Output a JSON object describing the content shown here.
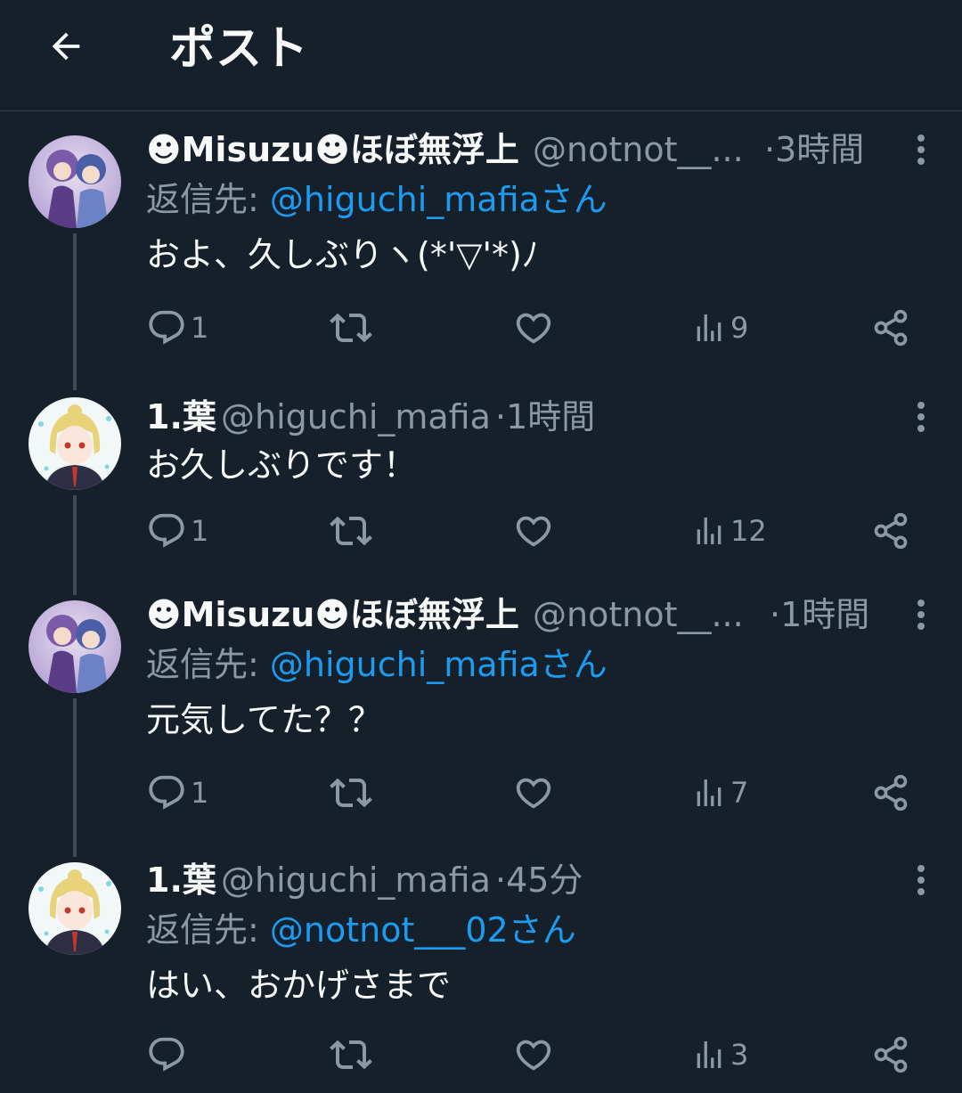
{
  "header": {
    "title": "ポスト"
  },
  "tweets": [
    {
      "display_name": "☻Misuzu☻ほぼ無浮上",
      "handle": "@notnot__...",
      "time": "·3時間",
      "reply_prefix": "返信先: ",
      "reply_to": "@higuchi_mafiaさん",
      "text": "およ、久しぶりヽ(*'▽'*)ﾉ",
      "replies": "1",
      "retweets": "",
      "likes": "",
      "views": "9"
    },
    {
      "display_name": "1.葉",
      "handle": "@higuchi_mafia",
      "time": "·1時間",
      "reply_prefix": "",
      "reply_to": "",
      "text": "お久しぶりです！",
      "replies": "1",
      "retweets": "",
      "likes": "",
      "views": "12"
    },
    {
      "display_name": "☻Misuzu☻ほぼ無浮上",
      "handle": "@notnot__...",
      "time": "·1時間",
      "reply_prefix": "返信先: ",
      "reply_to": "@higuchi_mafiaさん",
      "text": "元気してた？？",
      "replies": "1",
      "retweets": "",
      "likes": "",
      "views": "7"
    },
    {
      "display_name": "1.葉",
      "handle": "@higuchi_mafia",
      "time": "·45分",
      "reply_prefix": "返信先: ",
      "reply_to": "@notnot___02さん",
      "text": "はい、おかげさまで",
      "replies": "",
      "retweets": "",
      "likes": "",
      "views": "3"
    }
  ],
  "colors": {
    "background": "#15202b",
    "text": "#f7f9f9",
    "muted": "#8b98a5",
    "link": "#1d9bf0",
    "thread_line": "#3e4a55"
  },
  "icons": [
    "back-arrow-icon",
    "more-icon",
    "reply-icon",
    "retweet-icon",
    "like-icon",
    "views-icon",
    "share-icon"
  ]
}
